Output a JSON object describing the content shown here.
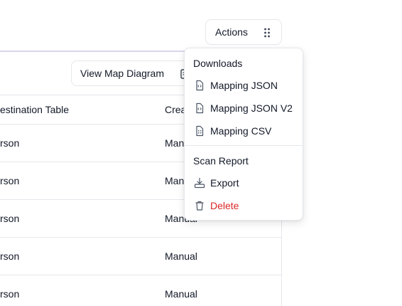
{
  "actions_button": {
    "label": "Actions",
    "icon": "grip-dots-icon"
  },
  "toolbar": {
    "map_button_label": "View Map Diagram",
    "map_button_icon": "diagram-icon"
  },
  "table": {
    "columns": [
      "estination Table",
      "Crea"
    ],
    "rows": [
      {
        "destination": "rson",
        "created": "Man"
      },
      {
        "destination": "rson",
        "created": "Man"
      },
      {
        "destination": "rson",
        "created": "Manual"
      },
      {
        "destination": "rson",
        "created": "Manual"
      },
      {
        "destination": "rson",
        "created": "Manual"
      }
    ]
  },
  "menu": {
    "downloads_label": "Downloads",
    "downloads": [
      {
        "label": "Mapping JSON",
        "icon": "file-code-icon"
      },
      {
        "label": "Mapping JSON V2",
        "icon": "file-code-icon"
      },
      {
        "label": "Mapping CSV",
        "icon": "file-spreadsheet-icon"
      }
    ],
    "scan_report_label": "Scan Report",
    "scan_report": [
      {
        "label": "Export",
        "icon": "download-tray-icon"
      },
      {
        "label": "Delete",
        "icon": "trash-icon",
        "color": "#dc2626"
      }
    ]
  }
}
